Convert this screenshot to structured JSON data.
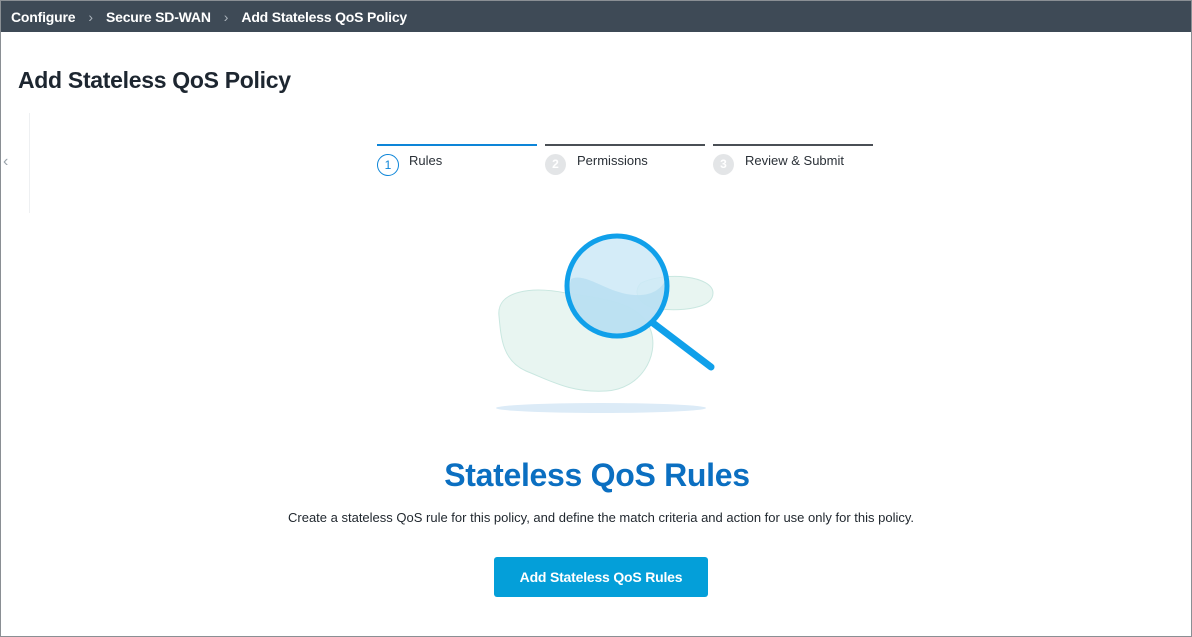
{
  "breadcrumb": {
    "items": [
      "Configure",
      "Secure SD-WAN",
      "Add Stateless QoS Policy"
    ],
    "separator": "›"
  },
  "page": {
    "title": "Add Stateless QoS Policy"
  },
  "sidebar_toggle": {
    "icon": "chevron-left-icon",
    "glyph": "‹"
  },
  "steps": [
    {
      "number": "1",
      "label": "Rules",
      "active": true
    },
    {
      "number": "2",
      "label": "Permissions",
      "active": false
    },
    {
      "number": "3",
      "label": "Review & Submit",
      "active": false
    }
  ],
  "empty_state": {
    "illustration": "magnifying-glass-icon",
    "title": "Stateless QoS Rules",
    "description": "Create a stateless QoS rule for this policy, and define the match criteria and action for use only for this policy.",
    "button_label": "Add Stateless QoS Rules"
  },
  "colors": {
    "topbar": "#3e4a56",
    "accent": "#0d85d8",
    "title_blue": "#0b6fc1",
    "button": "#049fd9"
  }
}
